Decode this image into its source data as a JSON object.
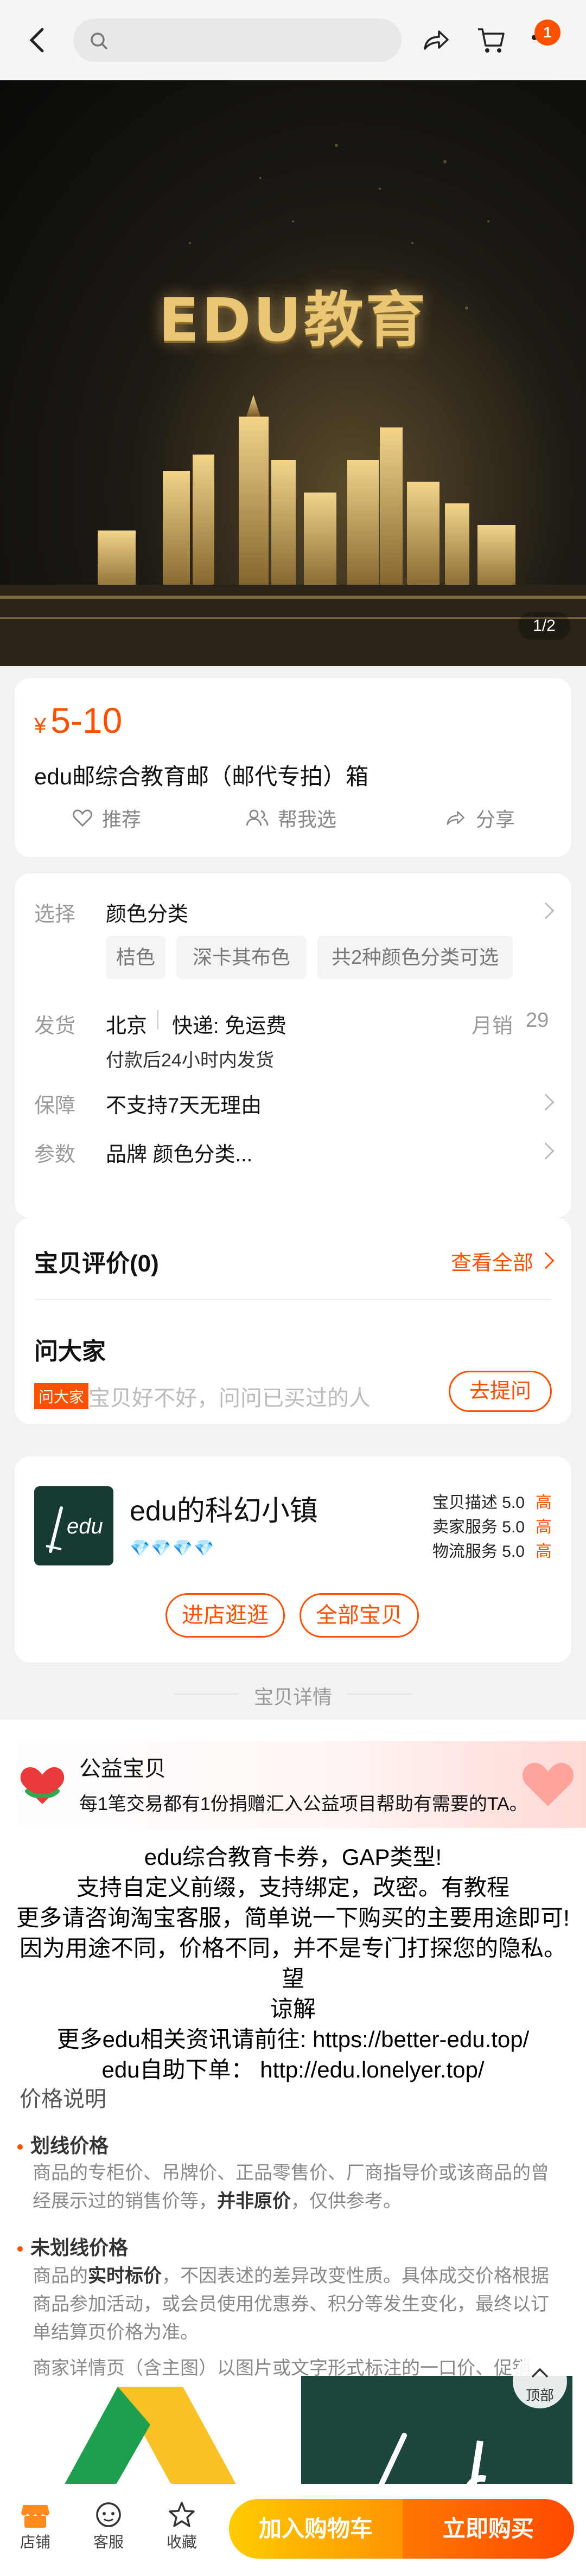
{
  "header": {
    "search_placeholder": "",
    "cart_badge": "1"
  },
  "hero": {
    "title": "EDU教育",
    "counter": "1/2"
  },
  "product": {
    "currency": "¥",
    "price": "5-10",
    "title": "edu邮综合教育邮（邮代专拍）箱",
    "actions": [
      "推荐",
      "帮我选",
      "分享"
    ]
  },
  "specs": {
    "select_label": "选择",
    "select_value": "颜色分类",
    "chips": [
      "桔色",
      "深卡其布色",
      "共2种颜色分类可选"
    ],
    "ship_label": "发货",
    "ship_city": "北京",
    "ship_method": "快递: 免运费",
    "sales_label": "月销",
    "sales_value": "29",
    "ship_time": "付款后24小时内发货",
    "guarantee_label": "保障",
    "guarantee_value": "不支持7天无理由",
    "params_label": "参数",
    "params_value": "品牌 颜色分类..."
  },
  "reviews": {
    "title": "宝贝评价(0)",
    "view_all": "查看全部",
    "qa_title": "问大家",
    "qa_tag": "问大家",
    "qa_hint": "宝贝好不好，问问已买过的人",
    "ask_button": "去提问"
  },
  "shop": {
    "logo_text": "edu",
    "name": "edu的科幻小镇",
    "diamonds": "💎💎💎💎",
    "scores": [
      {
        "label": "宝贝描述",
        "value": "5.0",
        "level": "高"
      },
      {
        "label": "卖家服务",
        "value": "5.0",
        "level": "高"
      },
      {
        "label": "物流服务",
        "value": "5.0",
        "level": "高"
      }
    ],
    "enter_button": "进店逛逛",
    "all_button": "全部宝贝"
  },
  "detail": {
    "divider": "宝贝详情",
    "charity_title": "公益宝贝",
    "charity_desc": "每1笔交易都有1份捐赠汇入公益项目帮助有需要的TA。",
    "lines": [
      "edu综合教育卡券，GAP类型!",
      "支持自定义前缀，支持绑定，改密。有教程",
      "更多请咨询淘宝客服，简单说一下购买的主要用途即可!",
      "因为用途不同，价格不同，并不是专门打探您的隐私。望",
      "谅解",
      "更多edu相关资讯请前往: https://better-edu.top/",
      "edu自助下单： http://edu.lonelyer.top/"
    ],
    "price_section": "价格说明",
    "price_items": [
      {
        "title": "划线价格",
        "text_a": "商品的专柜价、吊牌价、正品零售价、厂商指导价或该商品的曾经展示过的销售价等，",
        "bold": "并非原价",
        "text_b": "，仅供参考。"
      },
      {
        "title": "未划线价格",
        "text_a": "商品的",
        "bold": "实时标价",
        "text_b": "，不因表述的差异改变性质。具体成交价格根据商品参加活动，或会员使用优惠券、积分等发生变化，最终以订单结算页价格为准。"
      }
    ],
    "truncated_line": "商家详情页（含主图）以图片或文字形式标注的一口价、促销",
    "top_button": "顶部"
  },
  "bottom_bar": {
    "items": [
      "店铺",
      "客服",
      "收藏"
    ],
    "add_cart": "加入购物车",
    "buy_now": "立即购买"
  }
}
